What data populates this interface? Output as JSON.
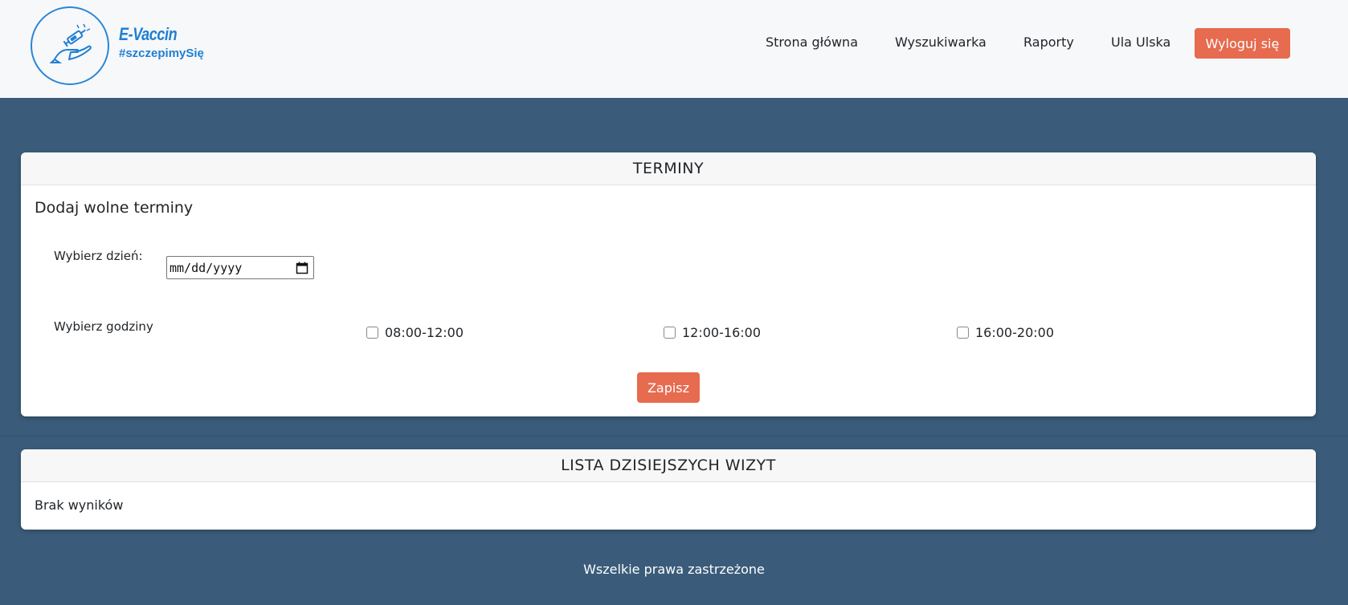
{
  "brand": {
    "title": "E-Vaccin",
    "tagline": "#szczepimySię",
    "logo_icon": "vaccine-hand-icon",
    "color": "#1f7fd3"
  },
  "nav": {
    "items": [
      {
        "label": "Strona główna"
      },
      {
        "label": "Wyszukiwarka"
      },
      {
        "label": "Raporty"
      },
      {
        "label": "Ula Ulska"
      }
    ],
    "logout_label": "Wyloguj się"
  },
  "terms": {
    "header": "TERMINY",
    "section_title": "Dodaj wolne terminy",
    "date_label": "Wybierz dzień:",
    "date_placeholder": "mm/dd/yyyy",
    "date_icon": "calendar-icon",
    "hours_label": "Wybierz godziny",
    "slots": [
      {
        "label": "08:00-12:00",
        "checked": false
      },
      {
        "label": "12:00-16:00",
        "checked": false
      },
      {
        "label": "16:00-20:00",
        "checked": false
      }
    ],
    "save_label": "Zapisz"
  },
  "visits": {
    "header": "LISTA DZISIEJSZYCH WIZYT",
    "empty_text": "Brak wyników"
  },
  "footer": {
    "text": "Wszelkie prawa zastrzeżone"
  },
  "colors": {
    "accent": "#e66b4f",
    "background": "#3a5c7a",
    "navbar": "#f7f8fa"
  }
}
